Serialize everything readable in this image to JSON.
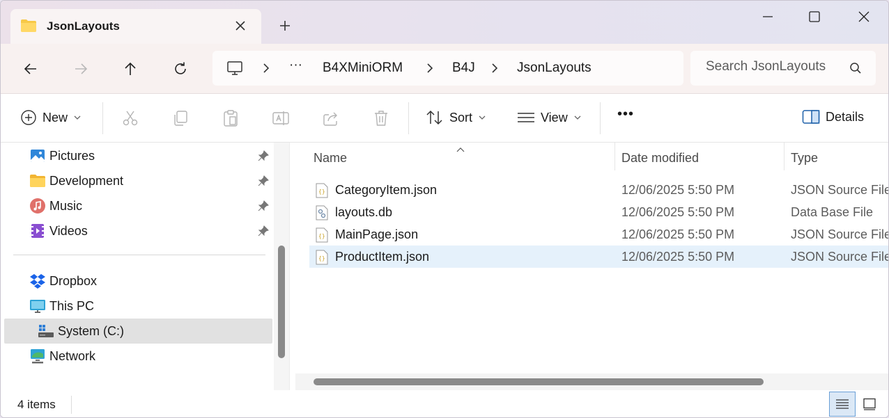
{
  "tab": {
    "title": "JsonLayouts"
  },
  "address": {
    "breadcrumbs": [
      "B4XMiniORM",
      "B4J",
      "JsonLayouts"
    ],
    "overflow": "···"
  },
  "search": {
    "placeholder": "Search JsonLayouts"
  },
  "command_bar": {
    "new_label": "New",
    "sort_label": "Sort",
    "view_label": "View",
    "more_label": "•••",
    "details_label": "Details"
  },
  "sidebar": {
    "items": [
      {
        "label": "Pictures",
        "icon": "pictures-icon",
        "pinned": true
      },
      {
        "label": "Development",
        "icon": "folder-icon",
        "pinned": true
      },
      {
        "label": "Music",
        "icon": "music-icon",
        "pinned": true
      },
      {
        "label": "Videos",
        "icon": "videos-icon",
        "pinned": true
      },
      {
        "label": "Dropbox",
        "icon": "dropbox-icon",
        "pinned": false
      },
      {
        "label": "This PC",
        "icon": "this-pc-icon",
        "pinned": false
      },
      {
        "label": "System (C:)",
        "icon": "drive-icon",
        "pinned": false,
        "selected": true
      },
      {
        "label": "Network",
        "icon": "network-icon",
        "pinned": false
      }
    ]
  },
  "columns": {
    "name": "Name",
    "date": "Date modified",
    "type": "Type"
  },
  "files": [
    {
      "name": "CategoryItem.json",
      "date": "12/06/2025 5:50 PM",
      "type": "JSON Source File",
      "icon": "json-file-icon"
    },
    {
      "name": "layouts.db",
      "date": "12/06/2025 5:50 PM",
      "type": "Data Base File",
      "icon": "db-file-icon"
    },
    {
      "name": "MainPage.json",
      "date": "12/06/2025 5:50 PM",
      "type": "JSON Source File",
      "icon": "json-file-icon"
    },
    {
      "name": "ProductItem.json",
      "date": "12/06/2025 5:50 PM",
      "type": "JSON Source File",
      "icon": "json-file-icon",
      "selected": true
    }
  ],
  "status": {
    "count": "4 items"
  },
  "colors": {
    "accent": "#0067c0",
    "selection": "#e5f1fb",
    "nav_selected": "#e1e1e1",
    "folder": "#f7c948"
  }
}
